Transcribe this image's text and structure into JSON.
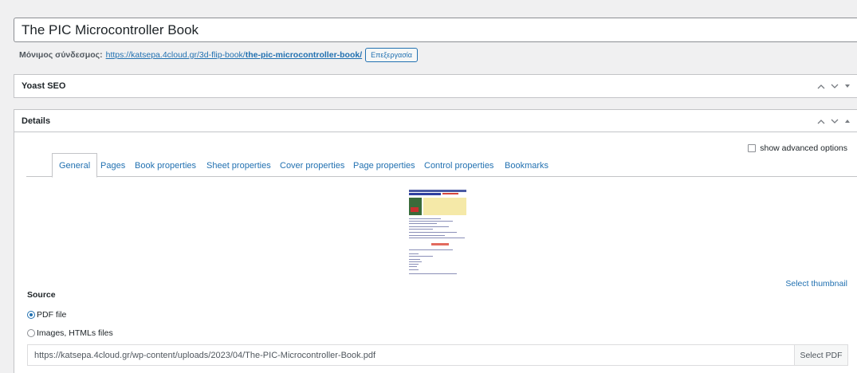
{
  "post": {
    "title": "The PIC Microcontroller Book",
    "permalink_label": "Μόνιμος σύνδεσμος:",
    "permalink_base": "https://katsepa.4cloud.gr/3d-flip-book/",
    "permalink_slug": "the-pic-microcontroller-book/",
    "edit_label": "Επεξεργασία"
  },
  "yoast": {
    "title": "Yoast SEO"
  },
  "details": {
    "title": "Details",
    "advanced_label": "show advanced options",
    "tabs": [
      {
        "label": "General",
        "active": true
      },
      {
        "label": "Pages"
      },
      {
        "label": "Book properties"
      },
      {
        "label": "Sheet properties"
      },
      {
        "label": "Cover properties"
      },
      {
        "label": "Page properties"
      },
      {
        "label": "Control properties"
      },
      {
        "label": "Bookmarks"
      }
    ],
    "select_thumbnail": "Select thumbnail",
    "source": {
      "title": "Source",
      "options": [
        {
          "label": "PDF file",
          "checked": true
        },
        {
          "label": "Images, HTMLs files",
          "checked": false
        }
      ],
      "pdf_url": "https://katsepa.4cloud.gr/wp-content/uploads/2023/04/The-PIC-Microcontroller-Book.pdf",
      "select_pdf_label": "Select PDF"
    }
  },
  "icons": {
    "up": "chevron-up-icon",
    "down": "chevron-down-icon",
    "toggle_collapsed": "triangle-down-icon",
    "toggle_expanded": "triangle-up-icon"
  },
  "colors": {
    "link": "#2271b1",
    "border": "#c3c4c7",
    "background": "#f0f0f1"
  }
}
